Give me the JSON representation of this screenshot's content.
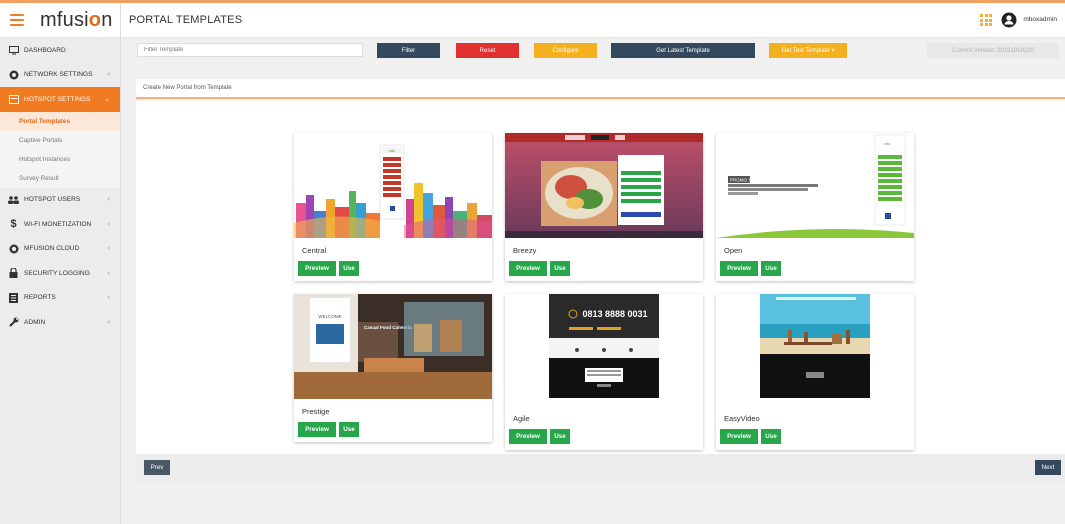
{
  "app": {
    "logo": "mfusi",
    "logo_o": "o",
    "logo_end": "n"
  },
  "header": {
    "title": "PORTAL TEMPLATES",
    "username": "mboxadmin"
  },
  "sidebar": {
    "items": [
      {
        "label": "DASHBOARD",
        "icon": "monitor-icon"
      },
      {
        "label": "NETWORK SETTINGS",
        "icon": "network-icon"
      },
      {
        "label": "HOTSPOT SETTINGS",
        "icon": "hotspot-icon"
      },
      {
        "label": "HOTSPOT USERS",
        "icon": "users-icon"
      },
      {
        "label": "WI-FI MONETIZATION",
        "icon": "dollar-icon"
      },
      {
        "label": "MFUSION CLOUD",
        "icon": "cloud-icon"
      },
      {
        "label": "SECURITY LOGGING",
        "icon": "lock-icon"
      },
      {
        "label": "REPORTS",
        "icon": "reports-icon"
      },
      {
        "label": "ADMIN",
        "icon": "wrench-icon"
      }
    ],
    "subitems": [
      "Portal Templates",
      "Captive Portals",
      "Hotspot Instances",
      "Survey Result"
    ]
  },
  "toolbar": {
    "filter_placeholder": "Filter Template",
    "filter": "Filter",
    "reset": "Reset",
    "configure": "Configure",
    "get_latest": "Get Latest Template",
    "get_test": "Get Test Template ▾",
    "version": "Current Version: 20191018220"
  },
  "panel": {
    "heading": "Create New Portal from Template"
  },
  "templates": [
    {
      "name": "Central"
    },
    {
      "name": "Breezy"
    },
    {
      "name": "Open"
    },
    {
      "name": "Prestige"
    },
    {
      "name": "Agile"
    },
    {
      "name": "EasyVideo"
    }
  ],
  "card_buttons": {
    "preview": "Preview",
    "use": "Use"
  },
  "thumb_text": {
    "open_promo": "PROMO 1",
    "prestige_sign": "Casual Food Cafeteria",
    "prestige_welcome": "WELCOME",
    "agile_phone": "0813 8888 0031"
  },
  "pager": {
    "prev": "Prev",
    "next": "Next"
  },
  "colors": {
    "accent": "#f07b22",
    "dark_btn": "#34495e",
    "red_btn": "#e03030",
    "yellow_btn": "#f5b020",
    "green_btn": "#27a74a"
  }
}
